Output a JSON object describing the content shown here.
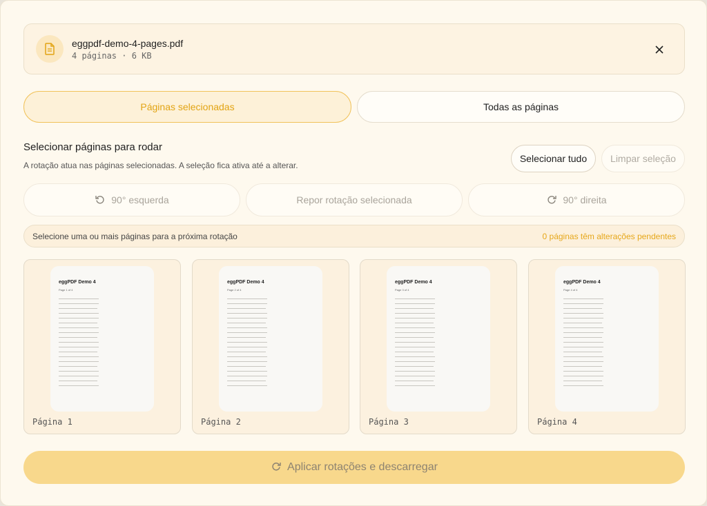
{
  "file": {
    "name": "eggpdf-demo-4-pages.pdf",
    "meta": "4 páginas · 6 KB",
    "icon": "document-icon",
    "close_icon": "close-icon"
  },
  "mode_tabs": [
    {
      "label": "Páginas selecionadas",
      "active": true
    },
    {
      "label": "Todas as páginas",
      "active": false
    }
  ],
  "section": {
    "title": "Selecionar páginas para rodar",
    "description": "A rotação atua nas páginas selecionadas. A seleção fica ativa até a alterar.",
    "select_all": "Selecionar tudo",
    "clear_selection": "Limpar seleção"
  },
  "rotation_buttons": {
    "left": "90° esquerda",
    "reset": "Repor rotação selecionada",
    "right": "90° direita"
  },
  "status": {
    "hint": "Selecione uma ou mais páginas para a próxima rotação",
    "pending": "0 páginas têm alterações pendentes"
  },
  "pages": [
    {
      "label": "Página 1",
      "thumb_title": "eggPDF Demo 4",
      "thumb_sub": "Page 1 of 4"
    },
    {
      "label": "Página 2",
      "thumb_title": "eggPDF Demo 4",
      "thumb_sub": "Page 2 of 4"
    },
    {
      "label": "Página 3",
      "thumb_title": "eggPDF Demo 4",
      "thumb_sub": "Page 3 of 4"
    },
    {
      "label": "Página 4",
      "thumb_title": "eggPDF Demo 4",
      "thumb_sub": "Page 4 of 4"
    }
  ],
  "apply": {
    "label": "Aplicar rotações e descarregar",
    "icon": "rotate-icon"
  },
  "colors": {
    "accent": "#e6a71a",
    "apply_bg": "#f8d88c",
    "panel_bg": "#fef9ee"
  }
}
